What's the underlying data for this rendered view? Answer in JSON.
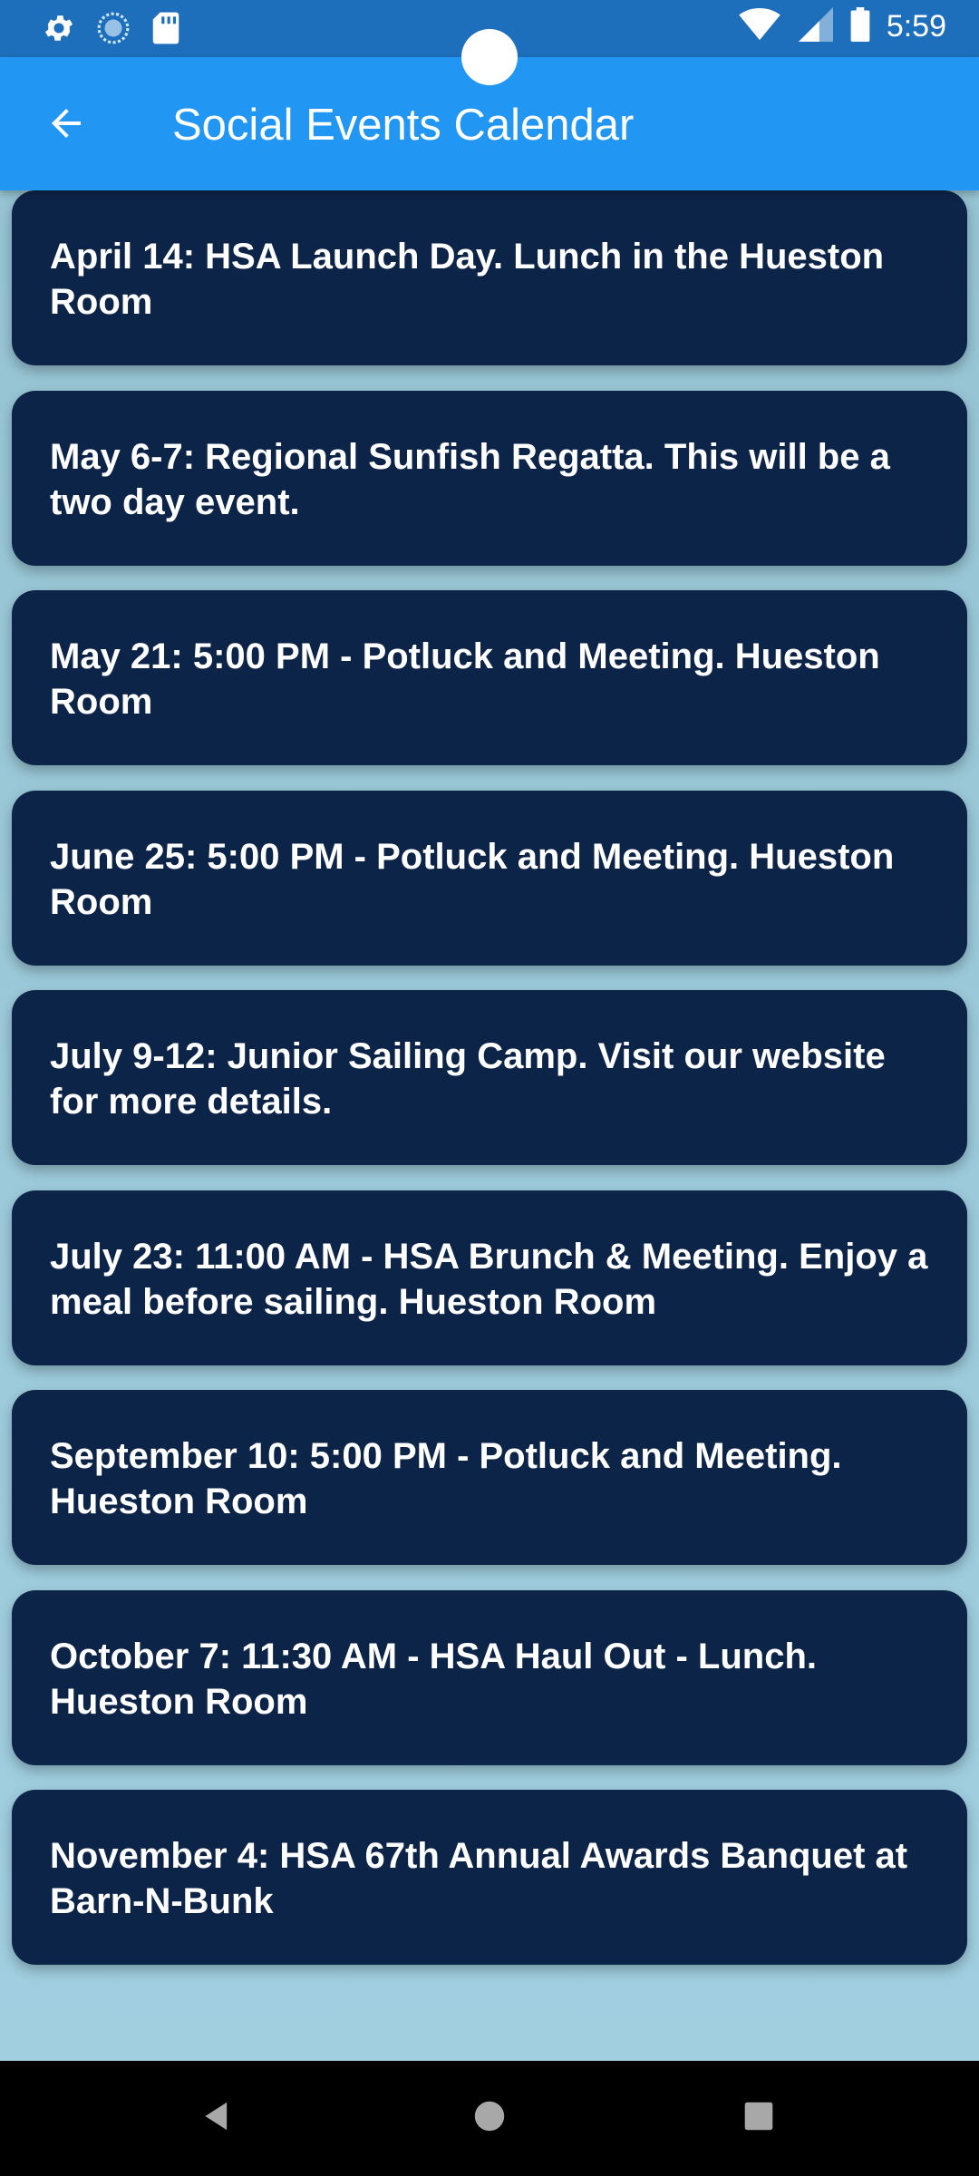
{
  "status_bar": {
    "time": "5:59",
    "left_icons": [
      "settings-icon",
      "sync-icon",
      "sd-card-icon"
    ],
    "right_icons": [
      "wifi-icon",
      "cell-signal-icon",
      "battery-icon"
    ]
  },
  "app_bar": {
    "title": "Social Events Calendar",
    "back_icon": "arrow-left-icon"
  },
  "events": [
    "April 14: HSA Launch Day. Lunch in the Hueston Room",
    "May 6-7: Regional Sunfish Regatta. This will be a two day event.",
    "May 21: 5:00 PM - Potluck and Meeting. Hueston Room",
    "June 25: 5:00 PM - Potluck and Meeting. Hueston Room",
    "July 9-12: Junior Sailing Camp. Visit our website for more details.",
    "July 23: 11:00 AM - HSA Brunch & Meeting. Enjoy a meal before sailing. Hueston Room",
    "September 10: 5:00 PM - Potluck and Meeting. Hueston Room",
    "October 7: 11:30 AM - HSA Haul Out - Lunch. Hueston Room",
    "November 4: HSA 67th Annual Awards Banquet at Barn-N-Bunk"
  ],
  "nav_bar": {
    "icons": [
      "back-triangle-icon",
      "home-circle-icon",
      "recents-square-icon"
    ]
  },
  "colors": {
    "status_bar": "#1d6fbc",
    "app_bar": "#2196f3",
    "card": "#0d2449",
    "background": "#a4d3e6"
  }
}
